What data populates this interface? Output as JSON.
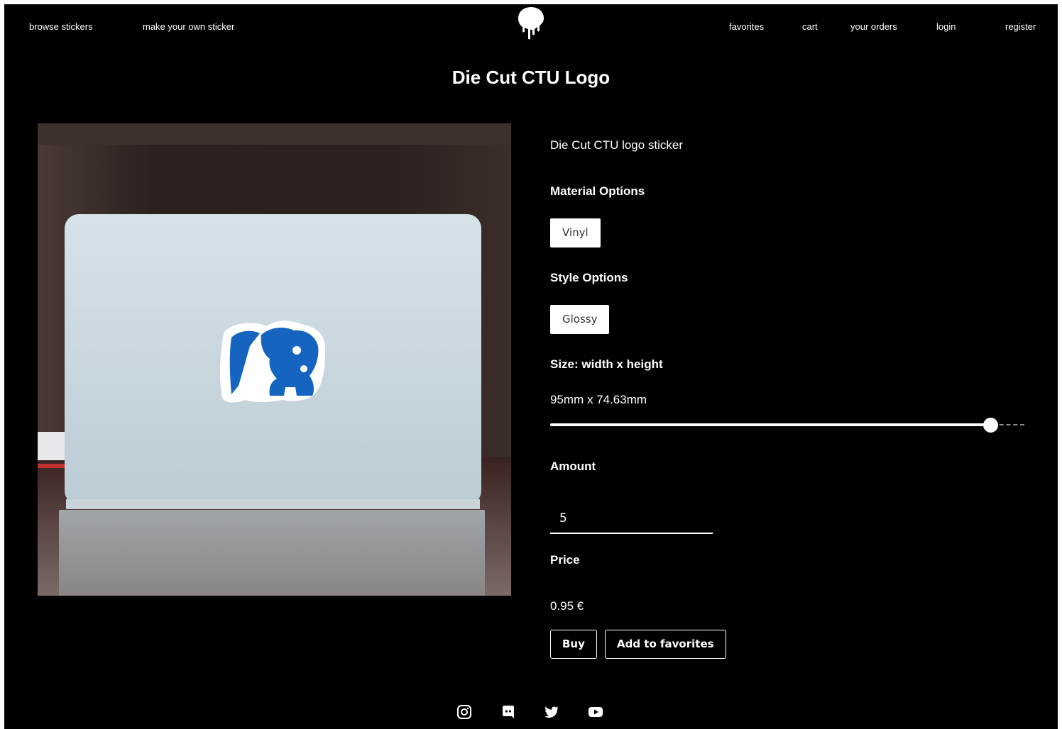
{
  "nav": {
    "left": [
      "browse stickers",
      "make your own sticker"
    ],
    "right": [
      "favorites",
      "cart",
      "your orders",
      "login",
      "register"
    ]
  },
  "product": {
    "title": "Die Cut CTU Logo",
    "description": "Die Cut CTU logo sticker",
    "image_alt": "Die Cut CTU logo sticker on a laptop lid"
  },
  "options": {
    "material_label": "Material Options",
    "material_value": "Vinyl",
    "style_label": "Style Options",
    "style_value": "Glossy",
    "size_label": "Size: width x height",
    "size_value": "95mm x 74.63mm",
    "size_slider_fraction": 0.93,
    "amount_label": "Amount",
    "amount_value": "5",
    "price_label": "Price",
    "price_value": "0.95 €"
  },
  "actions": {
    "buy": "Buy",
    "add_favorites": "Add to favorites"
  },
  "footer": {
    "icons": [
      "instagram-icon",
      "discord-icon",
      "twitter-icon",
      "youtube-icon"
    ]
  },
  "colors": {
    "background": "#000000",
    "text": "#ffffff",
    "logo_blue": "#1565c0"
  }
}
